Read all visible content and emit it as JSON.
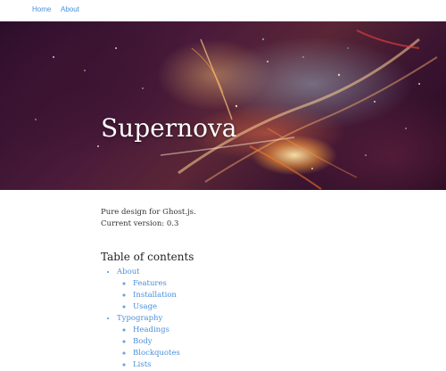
{
  "nav": {
    "items": [
      "Home",
      "About"
    ]
  },
  "hero": {
    "title": "Supernova"
  },
  "intro": {
    "line1": "Pure design for Ghost.js.",
    "line2": "Current version: 0.3"
  },
  "toc": {
    "heading": "Table of contents",
    "sections": [
      {
        "label": "About",
        "children": [
          "Features",
          "Installation",
          "Usage"
        ]
      },
      {
        "label": "Typography",
        "children": [
          "Headings",
          "Body",
          "Blockquotes",
          "Lists"
        ]
      }
    ]
  },
  "colors": {
    "link": "#4a90d9",
    "text": "#333333"
  }
}
